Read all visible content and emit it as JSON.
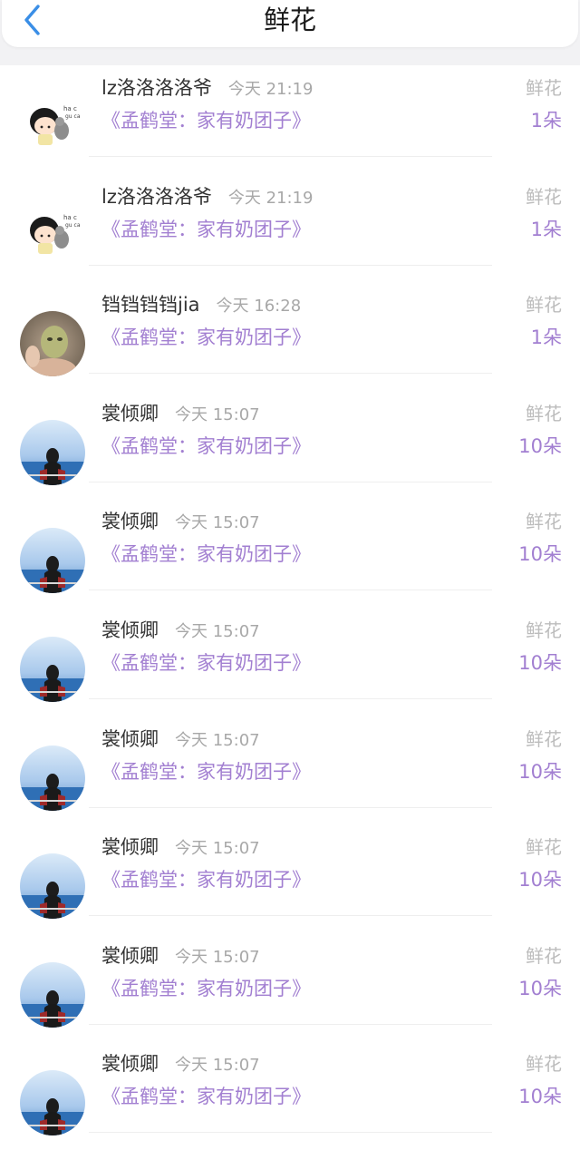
{
  "header": {
    "title": "鲜花",
    "back_icon": "chevron-left-icon",
    "accent_color": "#3a8ee6"
  },
  "rows": [
    {
      "user": "lz洛洛洛洛爷",
      "time": "今天 21:19",
      "book": "《孟鹤堂：家有奶团子》",
      "gift": "鲜花",
      "count": "1朵",
      "avatar": "cartoon-boy-avatar"
    },
    {
      "user": "lz洛洛洛洛爷",
      "time": "今天 21:19",
      "book": "《孟鹤堂：家有奶团子》",
      "gift": "鲜花",
      "count": "1朵",
      "avatar": "cartoon-boy-avatar"
    },
    {
      "user": "铛铛铛铛jia",
      "time": "今天 16:28",
      "book": "《孟鹤堂：家有奶团子》",
      "gift": "鲜花",
      "count": "1朵",
      "avatar": "face-mask-photo-avatar"
    },
    {
      "user": "裳倾卿",
      "time": "今天 15:07",
      "book": "《孟鹤堂：家有奶团子》",
      "gift": "鲜花",
      "count": "10朵",
      "avatar": "sea-view-girl-avatar"
    },
    {
      "user": "裳倾卿",
      "time": "今天 15:07",
      "book": "《孟鹤堂：家有奶团子》",
      "gift": "鲜花",
      "count": "10朵",
      "avatar": "sea-view-girl-avatar"
    },
    {
      "user": "裳倾卿",
      "time": "今天 15:07",
      "book": "《孟鹤堂：家有奶团子》",
      "gift": "鲜花",
      "count": "10朵",
      "avatar": "sea-view-girl-avatar"
    },
    {
      "user": "裳倾卿",
      "time": "今天 15:07",
      "book": "《孟鹤堂：家有奶团子》",
      "gift": "鲜花",
      "count": "10朵",
      "avatar": "sea-view-girl-avatar"
    },
    {
      "user": "裳倾卿",
      "time": "今天 15:07",
      "book": "《孟鹤堂：家有奶团子》",
      "gift": "鲜花",
      "count": "10朵",
      "avatar": "sea-view-girl-avatar"
    },
    {
      "user": "裳倾卿",
      "time": "今天 15:07",
      "book": "《孟鹤堂：家有奶团子》",
      "gift": "鲜花",
      "count": "10朵",
      "avatar": "sea-view-girl-avatar"
    },
    {
      "user": "裳倾卿",
      "time": "今天 15:07",
      "book": "《孟鹤堂：家有奶团子》",
      "gift": "鲜花",
      "count": "10朵",
      "avatar": "sea-view-girl-avatar"
    }
  ]
}
